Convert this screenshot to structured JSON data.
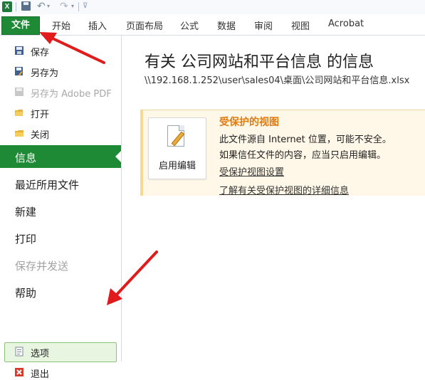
{
  "quick_access": {
    "app_icon": "X"
  },
  "ribbon": {
    "tabs": [
      "文件",
      "开始",
      "插入",
      "页面布局",
      "公式",
      "数据",
      "审阅",
      "视图",
      "Acrobat"
    ]
  },
  "backstage": {
    "small_items": [
      "保存",
      "另存为",
      "另存为 Adobe PDF",
      "打开",
      "关闭"
    ],
    "big_items": [
      "信息",
      "最近所用文件",
      "新建",
      "打印",
      "保存并发送",
      "帮助"
    ],
    "bottom_items": [
      "选项",
      "退出"
    ]
  },
  "info": {
    "title": "有关 公司网站和平台信息 的信息",
    "path": "\\\\192.168.1.252\\user\\sales04\\桌面\\公司网站和平台信息.xlsx",
    "protected": {
      "button_label": "启用编辑",
      "heading": "受保护的视图",
      "line1": "此文件源自 Internet 位置，可能不安全。",
      "line2": "如果信任文件的内容，应当只启用编辑。",
      "link1": "受保护视图设置",
      "link2": "了解有关受保护视图的详细信息"
    }
  },
  "colors": {
    "accent_green": "#1f8a36",
    "arrow_red": "#e11b1b",
    "warning_orange": "#e07b12"
  }
}
